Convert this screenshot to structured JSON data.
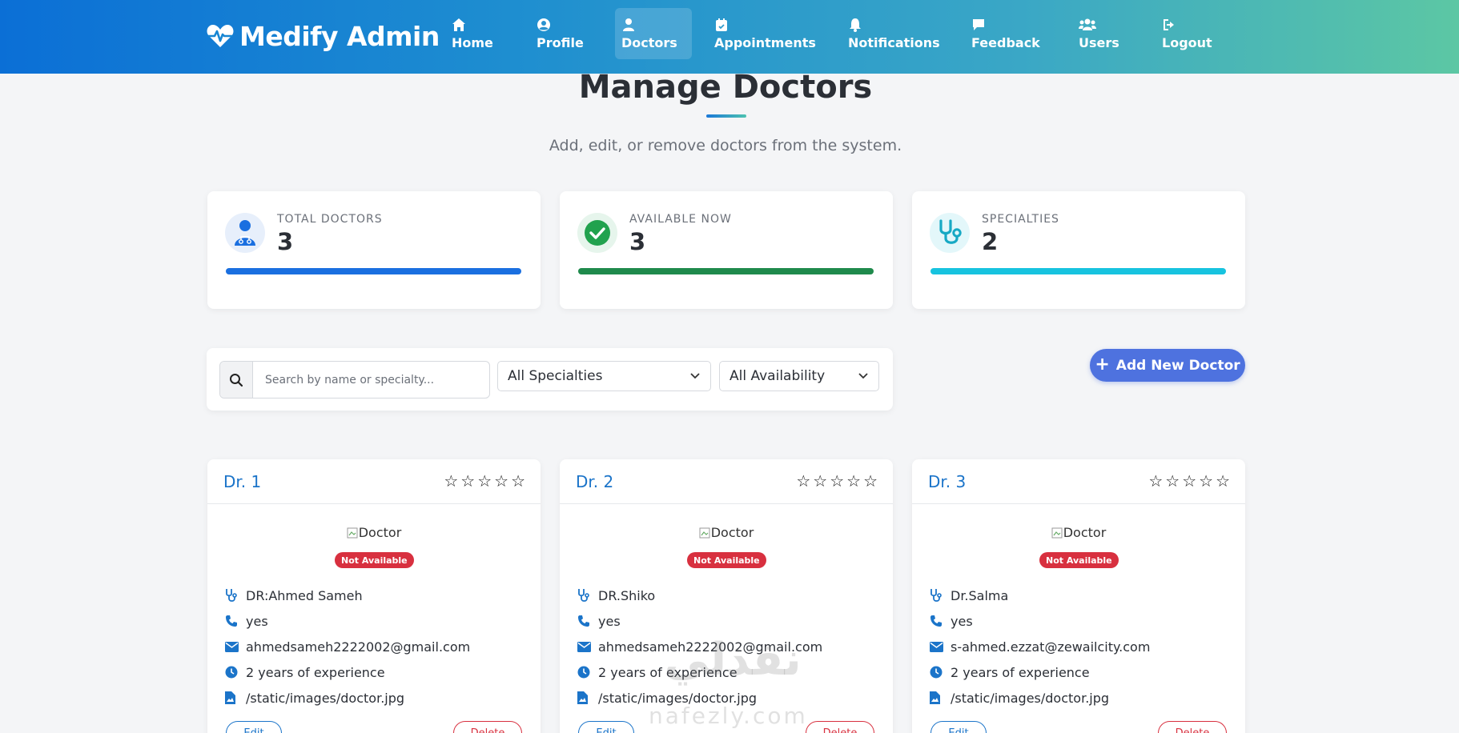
{
  "brand": {
    "name": "Medify Admin"
  },
  "nav": {
    "items": [
      {
        "label": "Home",
        "icon": "home-icon"
      },
      {
        "label": "Profile",
        "icon": "user-circle-icon"
      },
      {
        "label": "Doctors",
        "icon": "doctor-icon",
        "active": true
      },
      {
        "label": "Appointments",
        "icon": "calendar-icon"
      },
      {
        "label": "Notifications",
        "icon": "bell-icon"
      },
      {
        "label": "Feedback",
        "icon": "comment-icon"
      },
      {
        "label": "Users",
        "icon": "users-icon"
      },
      {
        "label": "Logout",
        "icon": "logout-icon"
      }
    ]
  },
  "header": {
    "title": "Manage Doctors",
    "subtitle": "Add, edit, or remove doctors from the system."
  },
  "stats": [
    {
      "label": "TOTAL DOCTORS",
      "value": "3",
      "icon": "doctor-icon",
      "color": "#1a6fe0"
    },
    {
      "label": "AVAILABLE NOW",
      "value": "3",
      "icon": "check-circle-icon",
      "color": "#1f8a4c"
    },
    {
      "label": "SPECIALTIES",
      "value": "2",
      "icon": "stethoscope-icon",
      "color": "#17c3df"
    }
  ],
  "filters": {
    "search_placeholder": "Search by name or specialty...",
    "specialty_selected": "All Specialties",
    "availability_selected": "All Availability"
  },
  "add_button": {
    "label": "Add New Doctor"
  },
  "doctor_cards": [
    {
      "title": "Dr. 1",
      "image_alt": "Doctor",
      "status": "Not Available",
      "name": "DR:Ahmed Sameh",
      "phone": "yes",
      "email": "ahmedsameh2222002@gmail.com",
      "experience": "2 years of experience",
      "image_path": "/static/images/doctor.jpg",
      "edit_label": "Edit",
      "delete_label": "Delete"
    },
    {
      "title": "Dr. 2",
      "image_alt": "Doctor",
      "status": "Not Available",
      "name": "DR.Shiko",
      "phone": "yes",
      "email": "ahmedsameh2222002@gmail.com",
      "experience": "2 years of experience",
      "image_path": "/static/images/doctor.jpg",
      "edit_label": "Edit",
      "delete_label": "Delete"
    },
    {
      "title": "Dr. 3",
      "image_alt": "Doctor",
      "status": "Not Available",
      "name": "Dr.Salma",
      "phone": "yes",
      "email": "s-ahmed.ezzat@zewailcity.com",
      "experience": "2 years of experience",
      "image_path": "/static/images/doctor.jpg",
      "edit_label": "Edit",
      "delete_label": "Delete"
    }
  ],
  "stars": "☆☆☆☆☆",
  "watermark": {
    "arabic": "نفذلي",
    "latin": "nafezly.com"
  },
  "colors": {
    "accent": "#4e72df",
    "link": "#1b74c9",
    "danger": "#d8303f"
  }
}
